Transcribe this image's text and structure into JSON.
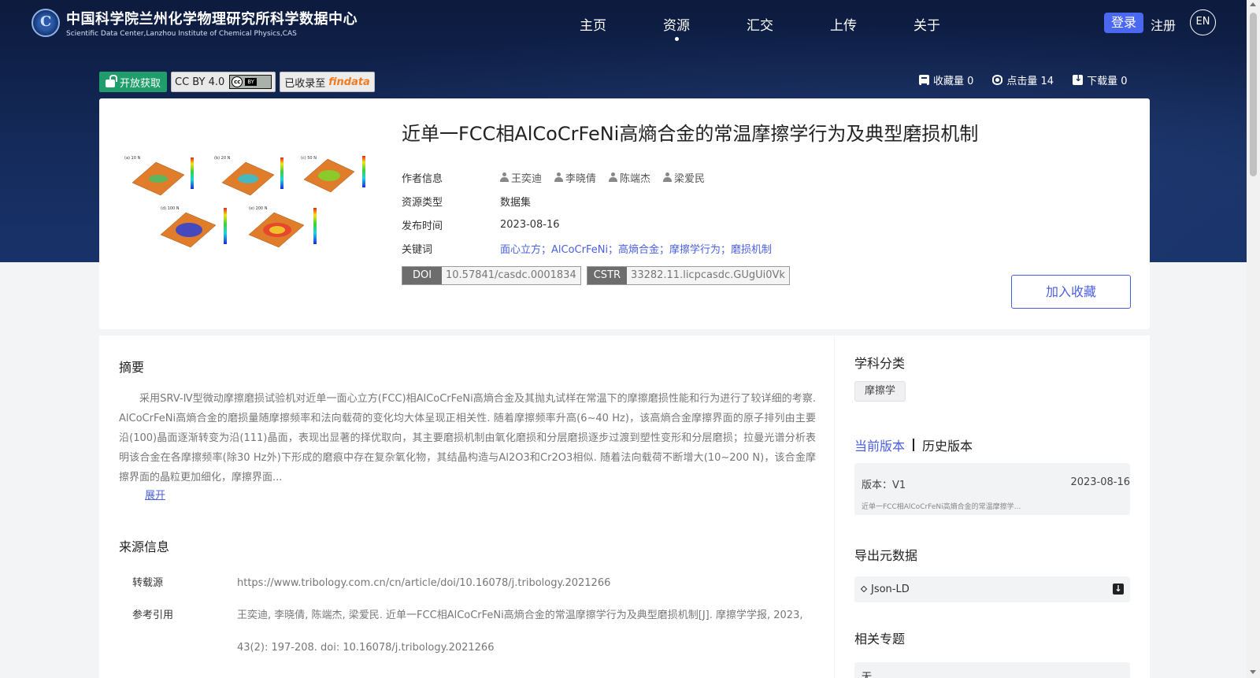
{
  "header": {
    "logo_cn": "中国科学院兰州化学物理研究所科学数据中心",
    "logo_en": "Scientific Data Center,Lanzhou Institute of Chemical Physics,CAS",
    "nav": [
      {
        "label": "主页",
        "active": false
      },
      {
        "label": "资源",
        "active": true
      },
      {
        "label": "汇交",
        "active": false
      },
      {
        "label": "上传",
        "active": false
      },
      {
        "label": "关于",
        "active": false
      }
    ],
    "login": "登录",
    "register": "注册",
    "lang": "EN"
  },
  "badges": {
    "open_access": "开放获取",
    "license": "CC BY 4.0",
    "cc_mark": "cc",
    "cc_by": "BY",
    "indexed_prefix": "已收录至",
    "findata": "findata"
  },
  "stats": {
    "favorites": "收藏量 0",
    "views": "点击量 14",
    "downloads": "下载量 0"
  },
  "record": {
    "title": "近单一FCC相AlCoCrFeNi高熵合金的常温摩擦学行为及典型磨损机制",
    "labels": {
      "authors": "作者信息",
      "type": "资源类型",
      "date": "发布时间",
      "keywords": "关键词"
    },
    "authors": [
      "王奕迪",
      "李晓倩",
      "陈端杰",
      "梁爱民"
    ],
    "type": "数据集",
    "date": "2023-08-16",
    "keywords": "面心立方；AlCoCrFeNi；高熵合金；摩擦学行为；磨损机制",
    "doi_label": "DOI",
    "doi": "10.57841/casdc.0001834",
    "cstr_label": "CSTR",
    "cstr": "33282.11.licpcasdc.GUgUi0Vk",
    "favorite_button": "加入收藏"
  },
  "thumbnail": {
    "panels": [
      "(a) 10 N",
      "(b) 20 N",
      "(c) 50 N",
      "(d) 100 N",
      "(e) 200 N"
    ]
  },
  "abstract": {
    "title": "摘要",
    "text": "采用SRV-Ⅳ型微动摩擦磨损试验机对近单一面心立方(FCC)相AlCoCrFeNi高熵合金及其抛丸试样在常温下的摩擦磨损性能和行为进行了较详细的考察. AlCoCrFeNi高熵合金的磨损量随摩擦频率和法向载荷的变化均大体呈现正相关性. 随着摩擦频率升高(6~40 Hz)，该高熵合金摩擦界面的原子排列由主要沿(100)晶面逐渐转变为沿(111)晶面，表现出显著的择优取向，其主要磨损机制由氧化磨损和分层磨损逐步过渡到塑性变形和分层磨损；拉曼光谱分析表明该合金在各摩擦频率(除30 Hz外)下形成的磨痕中存在复杂氧化物，其结晶构造与Al2O3和Cr2O3相似. 随着法向载荷不断增大(10~200 N)，该合金摩擦界面的晶粒更加细化，摩擦界面...",
    "expand": "展开"
  },
  "source": {
    "title": "来源信息",
    "repost_label": "转载源",
    "repost_url": "https://www.tribology.com.cn/cn/article/doi/10.16078/j.tribology.2021266",
    "cite_label": "参考引用",
    "cite_line1": "王奕迪, 李晓倩, 陈端杰, 梁爱民. 近单一FCC相AlCoCrFeNi高熵合金的常温摩擦学行为及典型磨损机制[J]. 摩擦学学报, 2023,",
    "cite_line2": "43(2): 197-208. doi: 10.16078/j.tribology.2021266"
  },
  "sidebar": {
    "subject_title": "学科分类",
    "subject_tag": "摩擦学",
    "version_current": "当前版本",
    "version_history": "历史版本",
    "version_label": "版本：V1",
    "version_date": "2023-08-16",
    "version_desc": "近单一FCC相AlCoCrFeNi高熵合金的常温摩擦学...",
    "export_title": "导出元数据",
    "export_option": "Json-LD",
    "topics_title": "相关专题",
    "topics_value": "无"
  },
  "colors": {
    "accent": "#4a5fe0",
    "open_badge": "#1f9d6a",
    "hero": "#0c1a3d"
  }
}
